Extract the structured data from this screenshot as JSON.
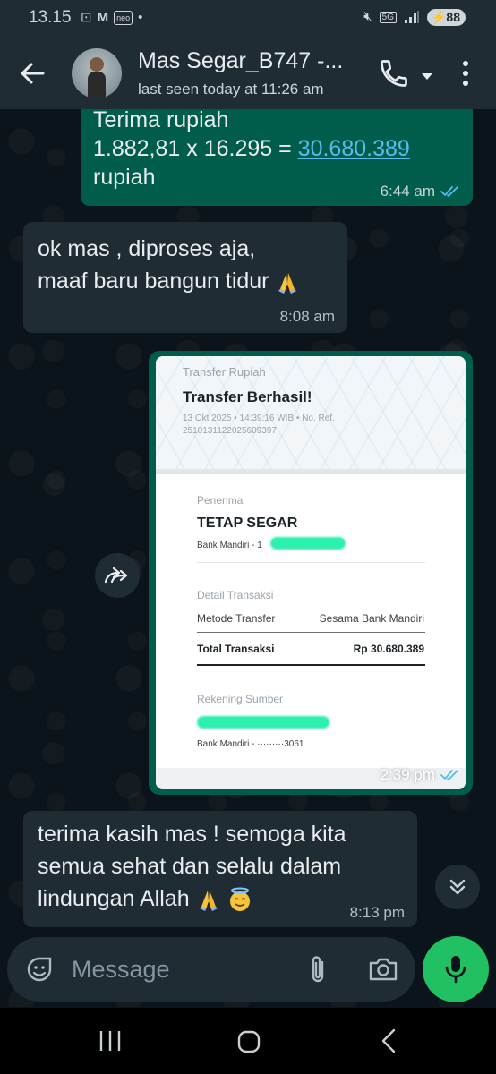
{
  "status_bar": {
    "time": "13.15",
    "badge": "neo",
    "network": "5G",
    "battery": "88"
  },
  "header": {
    "contact_name": "Mas Segar_B747 -...",
    "last_seen": "last seen today at 11:26 am"
  },
  "messages": [
    {
      "direction": "outgoing",
      "lines": [
        "Terima rupiah",
        "1.882,81 x 16.295 = ",
        "rupiah"
      ],
      "link": "30.680.389",
      "time": "6:44 am",
      "status": "read"
    },
    {
      "direction": "incoming",
      "lines": [
        "ok mas , diproses aja,",
        "maaf baru bangun tidur"
      ],
      "emoji": "folded-hands",
      "time": "8:08 am"
    },
    {
      "direction": "outgoing",
      "type": "image",
      "time": "2:39 pm",
      "status": "read",
      "receipt": {
        "title": "Transfer Rupiah",
        "heading": "Transfer Berhasil!",
        "date": "13 Okt 2025 • 14:39:16 WIB • No. Ref.",
        "ref": "2510131122025609397",
        "penerima_label": "Penerima",
        "penerima_name": "TETAP SEGAR",
        "penerima_bank": "Bank Mandiri - 1",
        "detail_label": "Detail Transaksi",
        "metode_label": "Metode Transfer",
        "metode_value": "Sesama Bank Mandiri",
        "total_label": "Total Transaksi",
        "total_value": "Rp 30.680.389",
        "rekening_label": "Rekening Sumber",
        "rekening_bank": "Bank Mandiri - ·········3061"
      }
    },
    {
      "direction": "incoming",
      "lines": [
        "terima kasih mas ! semoga kita",
        "semua sehat dan selalu dalam",
        "lindungan Allah"
      ],
      "emoji": [
        "folded-hands",
        "smiling-face-with-halo"
      ],
      "time": "8:13 pm"
    }
  ],
  "input": {
    "placeholder": "Message"
  },
  "colors": {
    "outgoing_bubble": "#005c4b",
    "incoming_bubble": "#202c33",
    "header": "#1f2c34",
    "accent_green": "#21c063",
    "link_blue": "#53bdeb"
  },
  "icons": [
    "back-arrow-icon",
    "phone-icon",
    "chevron-down-icon",
    "more-vert-icon",
    "forward-icon",
    "double-chevron-down-icon",
    "emoji-icon",
    "paperclip-icon",
    "camera-icon",
    "mic-icon",
    "nav-recent-icon",
    "nav-home-icon",
    "nav-back-icon"
  ]
}
